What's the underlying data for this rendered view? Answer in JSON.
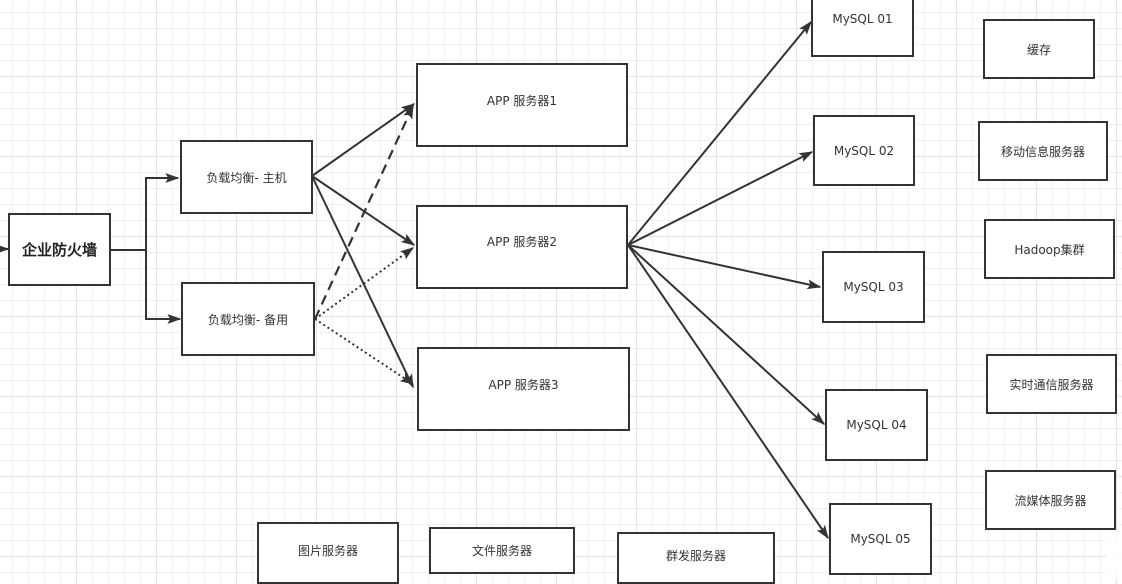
{
  "diagram": {
    "colors": {
      "stroke": "#333333",
      "text": "#333333",
      "background": "#ffffff",
      "grid": "#e2e2e2"
    },
    "nodes": {
      "firewall": "企业防火墙",
      "lb_primary": "负载均衡- 主机",
      "lb_backup": "负载均衡- 备用",
      "app1": "APP 服务器1",
      "app2": "APP 服务器2",
      "app3": "APP 服务器3",
      "mysql01": "MySQL 01",
      "mysql02": "MySQL 02",
      "mysql03": "MySQL 03",
      "mysql04": "MySQL 04",
      "mysql05": "MySQL 05",
      "cache": "缓存",
      "mobile_msg": "移动信息服务器",
      "hadoop": "Hadoop集群",
      "realtime_comm": "实时通信服务器",
      "streaming": "流媒体服务器",
      "image_server": "图片服务器",
      "file_server": "文件服务器",
      "broadcast_server": "群发服务器"
    },
    "edges": [
      {
        "from": "external",
        "to": "firewall",
        "style": "solid"
      },
      {
        "from": "firewall",
        "to": "lb_primary",
        "style": "solid",
        "routing": "orthogonal"
      },
      {
        "from": "firewall",
        "to": "lb_backup",
        "style": "solid",
        "routing": "orthogonal"
      },
      {
        "from": "lb_primary",
        "to": "app1",
        "style": "solid"
      },
      {
        "from": "lb_primary",
        "to": "app2",
        "style": "solid"
      },
      {
        "from": "lb_primary",
        "to": "app3",
        "style": "solid"
      },
      {
        "from": "lb_backup",
        "to": "app1",
        "style": "dashed"
      },
      {
        "from": "lb_backup",
        "to": "app2",
        "style": "dotted"
      },
      {
        "from": "lb_backup",
        "to": "app3",
        "style": "dotted"
      },
      {
        "from": "app2",
        "to": "mysql01",
        "style": "solid"
      },
      {
        "from": "app2",
        "to": "mysql02",
        "style": "solid"
      },
      {
        "from": "app2",
        "to": "mysql03",
        "style": "solid"
      },
      {
        "from": "app2",
        "to": "mysql04",
        "style": "solid"
      },
      {
        "from": "app2",
        "to": "mysql05",
        "style": "solid"
      }
    ]
  }
}
